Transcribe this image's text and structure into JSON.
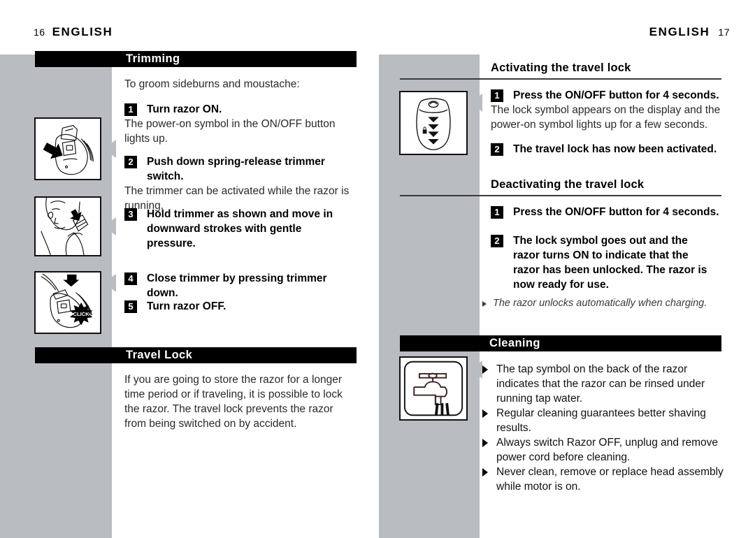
{
  "document": {
    "type": "appliance-instruction-manual-spread",
    "colors": {
      "gray_band": "#b9bcc1",
      "bar_black": "#000000",
      "rule": "#3b3b3b",
      "body_text": "#2a2a2a"
    }
  },
  "left_page": {
    "running_head": {
      "folio": "16",
      "title": "ENGLISH"
    },
    "section_trimming": {
      "bar_label": "Trimming",
      "intro": "To groom sideburns and moustache:",
      "steps": [
        {
          "number": "1",
          "lead": "Turn razor ON.",
          "continuation": "The power-on symbol in the ON/OFF button lights up."
        },
        {
          "number": "2",
          "lead": "Push down spring-release trimmer switch.",
          "continuation": "The trimmer can be activated while the razor is running."
        },
        {
          "number": "3",
          "lead": "Hold trimmer as shown and move in downward strokes with gentle pressure.",
          "continuation": ""
        },
        {
          "number": "4",
          "lead": "Close trimmer by pressing trimmer down.",
          "continuation": ""
        },
        {
          "number": "5",
          "lead": "Turn razor OFF.",
          "continuation": ""
        }
      ],
      "illustrations": [
        {
          "name": "razor-trimmer-release-illustration",
          "caption": ""
        },
        {
          "name": "man-trimming-sideburn-illustration",
          "caption": ""
        },
        {
          "name": "closing-trimmer-click-illustration",
          "caption": "CLICK"
        }
      ]
    },
    "section_travel_lock": {
      "bar_label": "Travel Lock",
      "paragraph": "If you are going to store the razor for a longer time period or if traveling, it is possible to lock the razor. The travel lock prevents the razor from being switched on by accident."
    }
  },
  "right_page": {
    "running_head": {
      "title": "ENGLISH",
      "folio": "17"
    },
    "section_activating": {
      "heading": "Activating the travel lock",
      "steps": [
        {
          "number": "1",
          "lead": "Press the ON/OFF button for 4 seconds.",
          "continuation": "The lock symbol appears on the display and the power-on symbol lights up for a few seconds."
        },
        {
          "number": "2",
          "lead": "The travel lock has now been activated.",
          "continuation": ""
        }
      ],
      "illustration": {
        "name": "razor-display-lock-symbol-illustration"
      }
    },
    "section_deactivating": {
      "heading": "Deactivating the travel lock",
      "steps": [
        {
          "number": "1",
          "lead": "Press the ON/OFF button for 4 seconds.",
          "continuation": ""
        },
        {
          "number": "2",
          "lead": "The lock symbol goes out and the razor turns ON to indicate that the razor has been unlocked. The razor is now ready for use.",
          "continuation": ""
        }
      ],
      "note": "The razor unlocks automatically when charging."
    },
    "section_cleaning": {
      "bar_label": "Cleaning",
      "illustration": {
        "name": "water-tap-symbol-illustration"
      },
      "bullets": [
        "The tap symbol on the back of the razor indicates that the razor can be rinsed under running tap water.",
        "Regular cleaning guarantees better shaving results.",
        "Always switch Razor OFF, unplug and remove power cord before cleaning.",
        "Never clean, remove or replace head assembly while motor is on."
      ]
    }
  }
}
